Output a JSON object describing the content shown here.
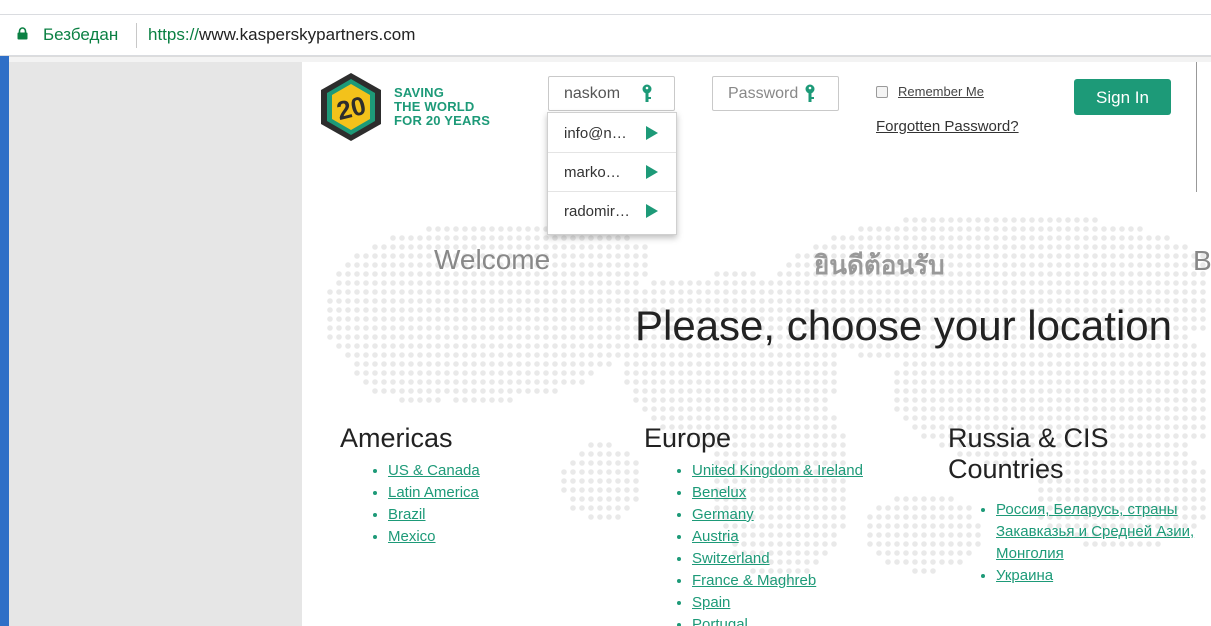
{
  "browser": {
    "security_label": "Безбедан",
    "url_scheme": "https://",
    "url_rest": "www.kasperskypartners.com",
    "colors": {
      "secure": "#0b8043"
    }
  },
  "logo": {
    "badge_text": "20",
    "tagline_lines": [
      "SAVING",
      "THE WORLD",
      "FOR 20 YEARS"
    ],
    "colors": {
      "badge_yellow": "#f3c21b",
      "badge_green": "#1d9a78",
      "badge_dark": "#2d2d2d"
    }
  },
  "login": {
    "username_value": "naskom",
    "password_placeholder": "Password",
    "remember_label": "Remember Me",
    "forgot_label": "Forgotten Password?",
    "signin_label": "Sign In",
    "autocomplete": [
      {
        "label": "info@n…"
      },
      {
        "label": "marko…"
      },
      {
        "label": "radomir…"
      }
    ],
    "colors": {
      "accent": "#1d9a78"
    }
  },
  "welcome": {
    "english": "Welcome",
    "thai": "ยินดีต้อนรับ",
    "partial": "B"
  },
  "headline": "Please, choose your location",
  "regions": {
    "americas": {
      "title": "Americas",
      "items": [
        "US & Canada",
        "Latin America",
        "Brazil",
        "Mexico"
      ]
    },
    "europe": {
      "title": "Europe",
      "items": [
        "United Kingdom & Ireland",
        "Benelux",
        "Germany",
        "Austria",
        "Switzerland",
        "France & Maghreb",
        "Spain",
        "Portugal"
      ]
    },
    "russia": {
      "title_line1": "Russia & CIS",
      "title_line2": "Countries",
      "items": [
        "Россия, Беларусь, страны Закавказья и Средней Азии, Монголия",
        "Украина"
      ]
    }
  }
}
